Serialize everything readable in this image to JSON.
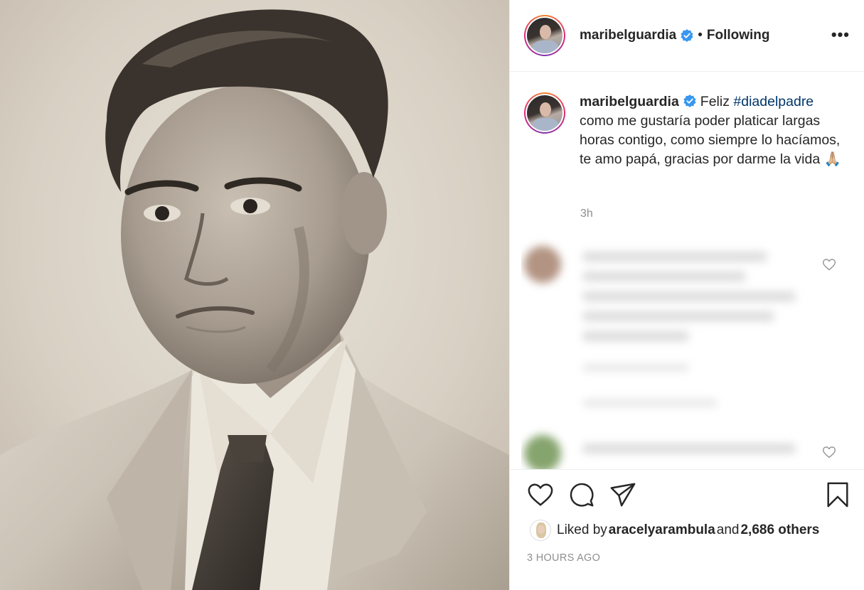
{
  "post": {
    "username": "maribelguardia",
    "separator": "•",
    "follow_status": "Following",
    "more_label": "•••"
  },
  "caption": {
    "username": "maribelguardia",
    "text_lead": "Feliz ",
    "hashtag": "#diadelpadre",
    "text_body": " como me gustaría poder platicar largas horas contigo, como siempre lo hacíamos, te amo papá, gracias por darme la vida ",
    "emoji": "🙏🏼",
    "time": "3h"
  },
  "likes": {
    "prefix": "Liked by ",
    "liker": "aracelyarambula",
    "middle": " and ",
    "others": "2,686 others"
  },
  "timestamp": "3 HOURS AGO",
  "icons": {
    "like": "heart-icon",
    "comment": "comment-icon",
    "share": "share-icon",
    "save": "bookmark-icon",
    "verified": "verified-badge-icon",
    "more": "more-options-icon"
  },
  "colors": {
    "verified_blue": "#3897f0",
    "hashtag": "#00376b",
    "muted": "#8e8e8e",
    "text": "#262626"
  }
}
